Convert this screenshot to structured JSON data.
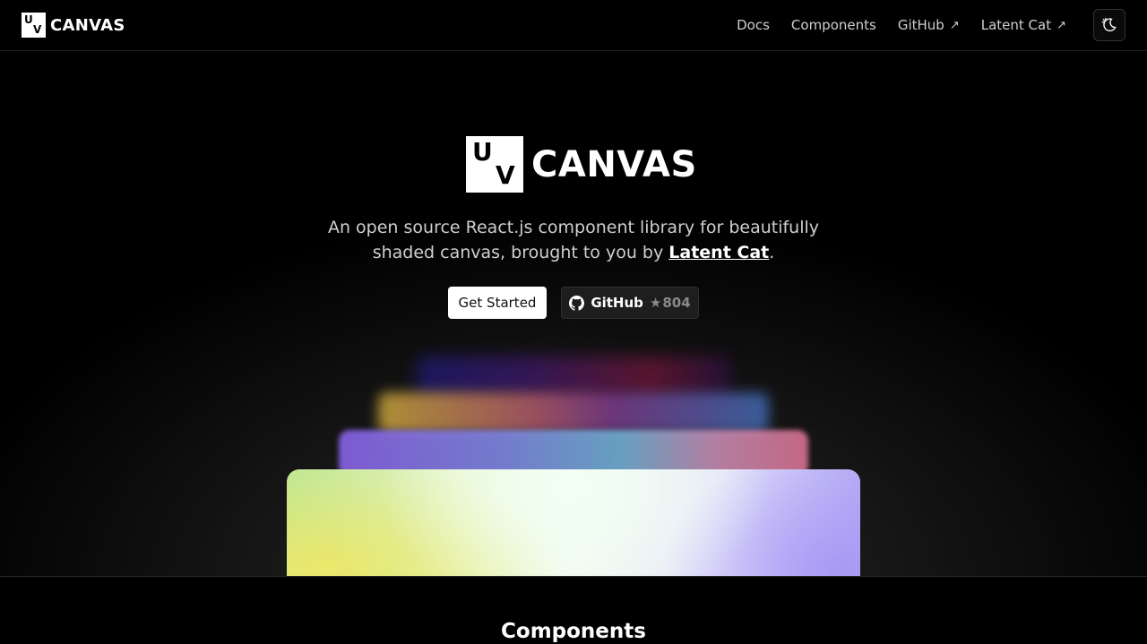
{
  "navbar": {
    "brand_text": "CANVAS",
    "logo_u": "U",
    "logo_v": "V",
    "links": [
      {
        "label": "Docs",
        "external": false
      },
      {
        "label": "Components",
        "external": false
      },
      {
        "label": "GitHub",
        "external": true
      },
      {
        "label": "Latent Cat",
        "external": true
      }
    ],
    "external_arrow": "↗",
    "theme_toggle_icon": "moon-sun-icon"
  },
  "hero": {
    "logo_u": "U",
    "logo_v": "V",
    "title": "CANVAS",
    "tagline_prefix": "An open source React.js component library for beautifully shaded canvas, brought to you by ",
    "tagline_link": "Latent Cat",
    "tagline_suffix": ".",
    "get_started_label": "Get Started",
    "github_label": "GitHub",
    "github_star_icon": "★",
    "github_stars": "804"
  },
  "components_section": {
    "title": "Components"
  },
  "colors": {
    "background": "#000000",
    "text": "#ffffff",
    "muted_text": "#cfcfcf",
    "primary_button_bg": "#ffffff",
    "secondary_button_bg": "#1e1e1e"
  }
}
